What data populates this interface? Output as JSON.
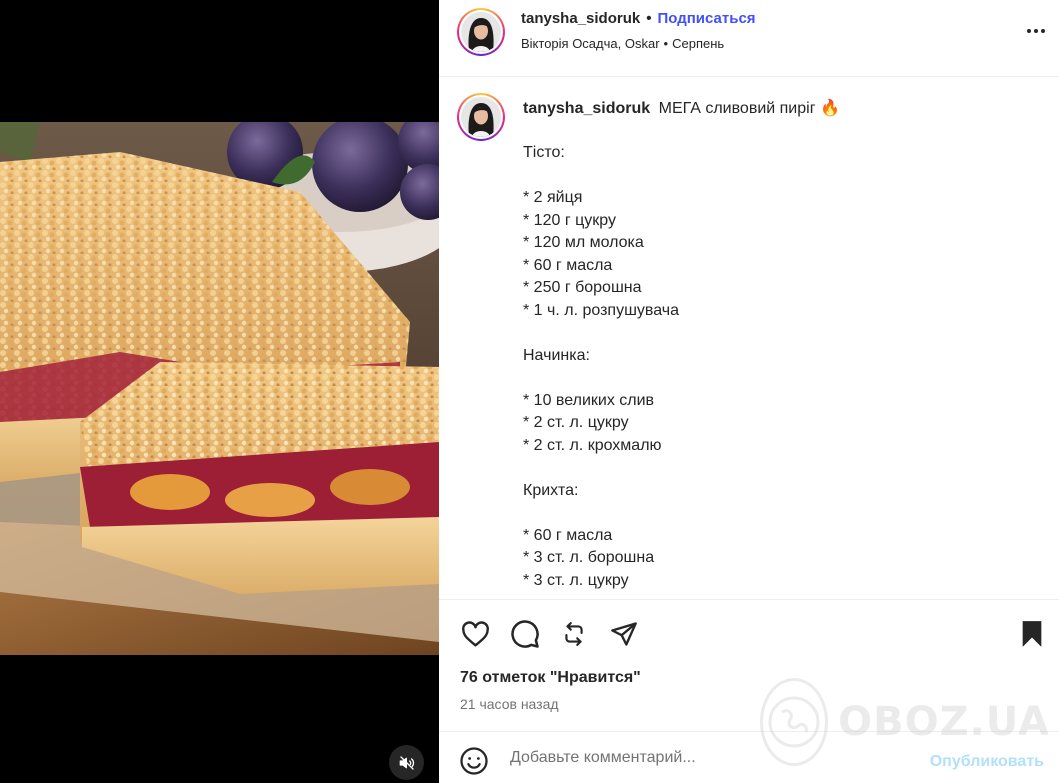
{
  "header": {
    "username": "tanysha_sidoruk",
    "separator": "•",
    "follow_label": "Подписаться",
    "collaborators": "Вікторія Осадча, Oskar",
    "audio_separator": "•",
    "audio": "Серпень",
    "more_icon": "more-horizontal-icon"
  },
  "caption": {
    "username": "tanysha_sidoruk",
    "title": "МЕГА сливовий пиріг",
    "title_emoji": "🔥",
    "body": "Тісто:\n\n* 2 яйця\n* 120 г цукру\n* 120 мл молока\n* 60 г масла\n* 250 г борошна\n* 1 ч. л. розпушувача\n\nНачинка:\n\n* 10 великих слив\n* 2 ст. л. цукру\n* 2 ст. л. крохмалю\n\nКрихта:\n\n* 60 г масла\n* 3 ст. л. борошна\n* 3 ст. л. цукру"
  },
  "actions": {
    "like_icon": "heart-icon",
    "comment_icon": "comment-icon",
    "repost_icon": "repost-icon",
    "share_icon": "share-icon",
    "save_icon": "bookmark-icon"
  },
  "likes_label": "76 отметок \"Нравится\"",
  "time_label": "21 часов назад",
  "comment": {
    "placeholder": "Добавьте комментарий...",
    "publish_label": "Опубликовать",
    "emoji_icon": "emoji-icon"
  },
  "media": {
    "mute_icon": "muted-speaker-icon"
  },
  "watermark": {
    "text": "OBOZ.UA"
  },
  "colors": {
    "follow": "#4150f7",
    "publish_disabled": "#b2dffc",
    "secondary_text": "#737373"
  }
}
